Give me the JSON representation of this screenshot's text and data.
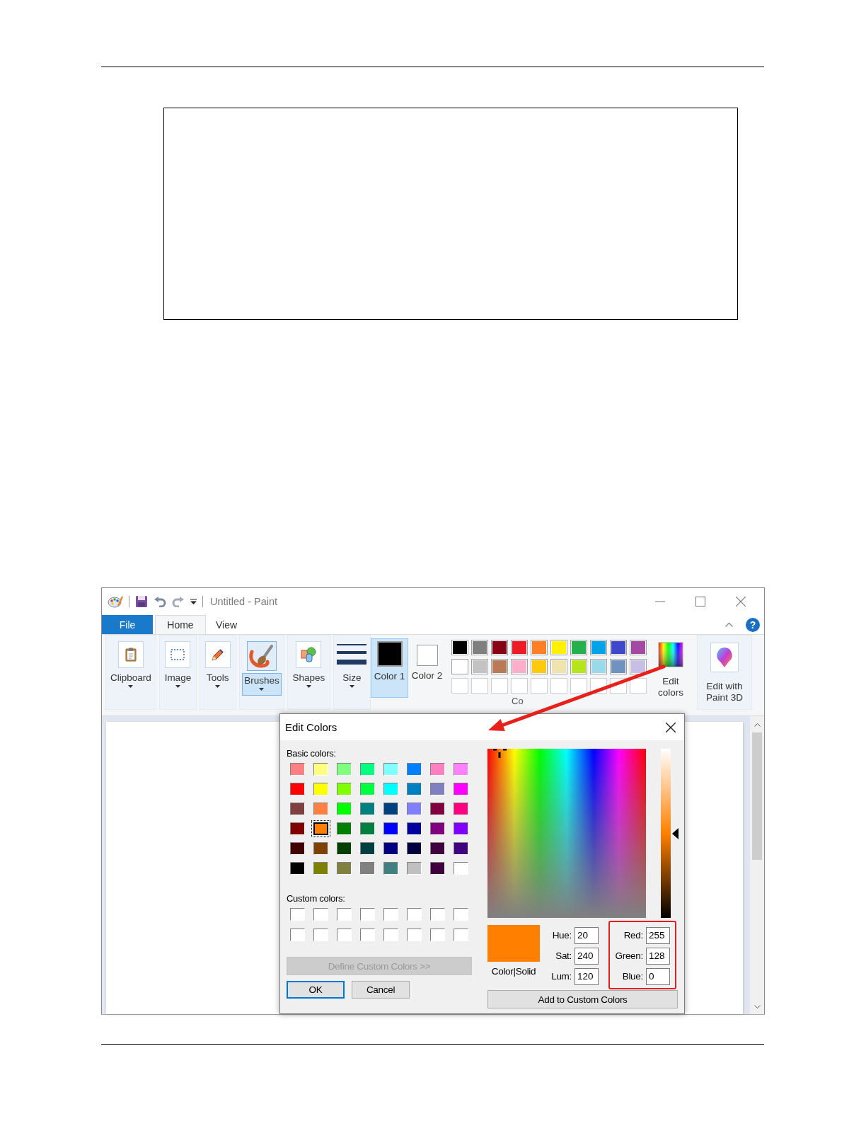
{
  "window": {
    "title": "Untitled - Paint"
  },
  "tabs": [
    {
      "label": "File",
      "kind": "file",
      "selected": false
    },
    {
      "label": "Home",
      "kind": "tab",
      "selected": true
    },
    {
      "label": "View",
      "kind": "tab",
      "selected": false
    }
  ],
  "help": "?",
  "tools": [
    {
      "label": "Clipboard",
      "kind": "clipboard",
      "selected": false
    },
    {
      "label": "Image",
      "kind": "image",
      "selected": false
    },
    {
      "label": "Tools",
      "kind": "tools",
      "selected": false
    },
    {
      "label": "Brushes",
      "kind": "brushes",
      "selected": true
    },
    {
      "label": "Shapes",
      "kind": "shapes",
      "selected": false
    },
    {
      "label": "Size",
      "kind": "size",
      "selected": false
    }
  ],
  "colors": {
    "color1": {
      "label": "Color 1",
      "color": "#000000",
      "selected": true
    },
    "color2": {
      "label": "Color 2",
      "color": "#ffffff",
      "selected": false
    },
    "palette": [
      {
        "kind": "swatch",
        "color": "#000000"
      },
      {
        "kind": "swatch",
        "color": "#7f7f7f"
      },
      {
        "kind": "swatch",
        "color": "#880015"
      },
      {
        "kind": "swatch",
        "color": "#ed1c24"
      },
      {
        "kind": "swatch",
        "color": "#ff7f27"
      },
      {
        "kind": "swatch",
        "color": "#fff200"
      },
      {
        "kind": "swatch",
        "color": "#22b14c"
      },
      {
        "kind": "swatch",
        "color": "#00a2e8"
      },
      {
        "kind": "swatch",
        "color": "#3f48cc"
      },
      {
        "kind": "swatch",
        "color": "#a349a4"
      },
      {
        "kind": "swatch",
        "color": "#ffffff"
      },
      {
        "kind": "swatch",
        "color": "#c3c3c3"
      },
      {
        "kind": "swatch",
        "color": "#b97a57"
      },
      {
        "kind": "swatch",
        "color": "#ffaec9"
      },
      {
        "kind": "swatch",
        "color": "#ffc90e"
      },
      {
        "kind": "swatch",
        "color": "#efe4b0"
      },
      {
        "kind": "swatch",
        "color": "#b5e61d"
      },
      {
        "kind": "swatch",
        "color": "#99d9ea"
      },
      {
        "kind": "swatch",
        "color": "#7092be"
      },
      {
        "kind": "swatch",
        "color": "#c8bfe7"
      },
      {
        "kind": "empty"
      },
      {
        "kind": "empty"
      },
      {
        "kind": "empty"
      },
      {
        "kind": "empty"
      },
      {
        "kind": "empty"
      },
      {
        "kind": "empty"
      },
      {
        "kind": "empty"
      },
      {
        "kind": "empty"
      },
      {
        "kind": "empty"
      },
      {
        "kind": "empty"
      }
    ],
    "group_label": "Co",
    "edit_button": "Edit colors"
  },
  "paint3d_button": "Edit with Paint 3D",
  "dialog": {
    "title": "Edit Colors",
    "basic_label": "Basic colors:",
    "basic_colors": [
      {
        "color": "#ff8080",
        "selected": false
      },
      {
        "color": "#ffff80",
        "selected": false
      },
      {
        "color": "#80ff80",
        "selected": false
      },
      {
        "color": "#00ff80",
        "selected": false
      },
      {
        "color": "#80ffff",
        "selected": false
      },
      {
        "color": "#0080ff",
        "selected": false
      },
      {
        "color": "#ff80c0",
        "selected": false
      },
      {
        "color": "#ff80ff",
        "selected": false
      },
      {
        "color": "#ff0000",
        "selected": false
      },
      {
        "color": "#ffff00",
        "selected": false
      },
      {
        "color": "#80ff00",
        "selected": false
      },
      {
        "color": "#00ff40",
        "selected": false
      },
      {
        "color": "#00ffff",
        "selected": false
      },
      {
        "color": "#0080c0",
        "selected": false
      },
      {
        "color": "#8080c0",
        "selected": false
      },
      {
        "color": "#ff00ff",
        "selected": false
      },
      {
        "color": "#804040",
        "selected": false
      },
      {
        "color": "#ff8040",
        "selected": false
      },
      {
        "color": "#00ff00",
        "selected": false
      },
      {
        "color": "#008080",
        "selected": false
      },
      {
        "color": "#004080",
        "selected": false
      },
      {
        "color": "#8080ff",
        "selected": false
      },
      {
        "color": "#800040",
        "selected": false
      },
      {
        "color": "#ff0080",
        "selected": false
      },
      {
        "color": "#800000",
        "selected": false
      },
      {
        "color": "#ff8000",
        "selected": true
      },
      {
        "color": "#008000",
        "selected": false
      },
      {
        "color": "#008040",
        "selected": false
      },
      {
        "color": "#0000ff",
        "selected": false
      },
      {
        "color": "#0000a0",
        "selected": false
      },
      {
        "color": "#800080",
        "selected": false
      },
      {
        "color": "#8000ff",
        "selected": false
      },
      {
        "color": "#400000",
        "selected": false
      },
      {
        "color": "#804000",
        "selected": false
      },
      {
        "color": "#004000",
        "selected": false
      },
      {
        "color": "#004040",
        "selected": false
      },
      {
        "color": "#000080",
        "selected": false
      },
      {
        "color": "#000040",
        "selected": false
      },
      {
        "color": "#400040",
        "selected": false
      },
      {
        "color": "#400080",
        "selected": false
      },
      {
        "color": "#000000",
        "selected": false
      },
      {
        "color": "#808000",
        "selected": false
      },
      {
        "color": "#808040",
        "selected": false
      },
      {
        "color": "#808080",
        "selected": false
      },
      {
        "color": "#408080",
        "selected": false
      },
      {
        "color": "#c0c0c0",
        "selected": false
      },
      {
        "color": "#400040",
        "selected": false
      },
      {
        "color": "#ffffff",
        "selected": false
      }
    ],
    "custom_label": "Custom colors:",
    "custom_colors": [
      {
        "kind": "empty"
      },
      {
        "kind": "empty"
      },
      {
        "kind": "empty"
      },
      {
        "kind": "empty"
      },
      {
        "kind": "empty"
      },
      {
        "kind": "empty"
      },
      {
        "kind": "empty"
      },
      {
        "kind": "empty"
      },
      {
        "kind": "empty"
      },
      {
        "kind": "empty"
      },
      {
        "kind": "empty"
      },
      {
        "kind": "empty"
      },
      {
        "kind": "empty"
      },
      {
        "kind": "empty"
      },
      {
        "kind": "empty"
      },
      {
        "kind": "empty"
      }
    ],
    "define_button": {
      "label": "Define Custom Colors >>",
      "disabled": true
    },
    "ok_button": {
      "label": "OK",
      "default": true
    },
    "cancel_button": {
      "label": "Cancel",
      "default": false
    },
    "lum_slider": {
      "level": 0.5
    },
    "preview": {
      "color": "#ff8000",
      "label": "Color|Solid"
    },
    "hsl_fields": [
      {
        "label": "Hue:",
        "value": "20"
      },
      {
        "label": "Sat:",
        "value": "240"
      },
      {
        "label": "Lum:",
        "value": "120"
      }
    ],
    "rgb_fields": {
      "highlighted": true,
      "fields": [
        {
          "label": "Red:",
          "value": "255"
        },
        {
          "label": "Green:",
          "value": "128"
        },
        {
          "label": "Blue:",
          "value": "0"
        }
      ]
    },
    "add_button": "Add to Custom Colors"
  }
}
